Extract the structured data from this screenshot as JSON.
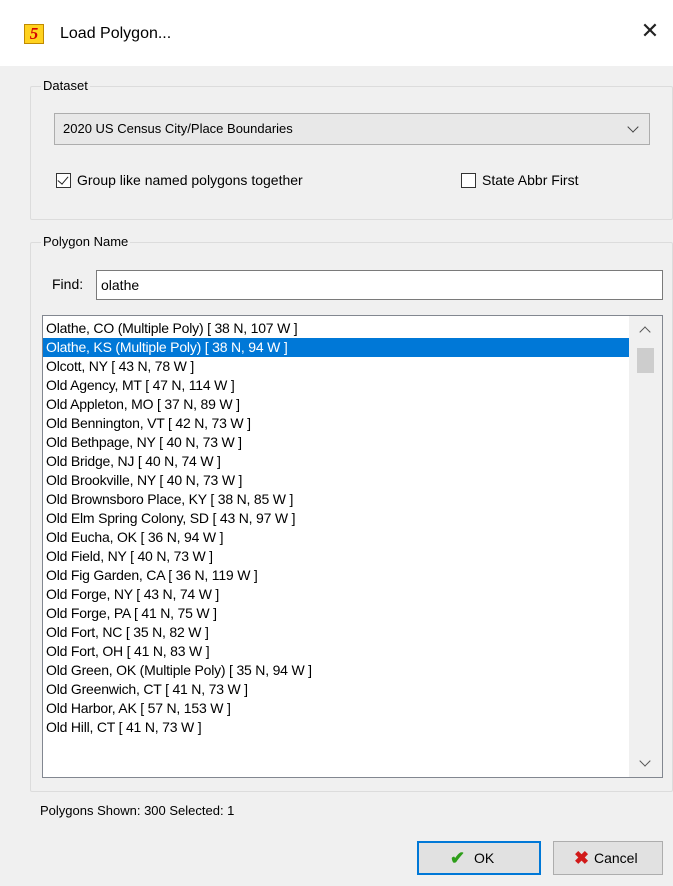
{
  "window": {
    "title": "Load Polygon...",
    "app_icon_glyph": "5",
    "close_glyph": "✕"
  },
  "dataset": {
    "legend": "Dataset",
    "selected": "2020 US Census City/Place Boundaries",
    "group_like_named": {
      "label": "Group like named polygons together",
      "checked": true
    },
    "state_abbr_first": {
      "label": "State Abbr First",
      "checked": false
    }
  },
  "polygon_name": {
    "legend": "Polygon Name",
    "find_label": "Find:",
    "find_value": "olathe",
    "items": [
      "Olathe, CO (Multiple Poly)  [ 38 N, 107 W ]",
      "Olathe, KS (Multiple Poly)  [ 38 N, 94 W ]",
      "Olcott, NY  [ 43 N, 78 W ]",
      "Old Agency, MT  [ 47 N, 114 W ]",
      "Old Appleton, MO  [ 37 N, 89 W ]",
      "Old Bennington, VT  [ 42 N, 73 W ]",
      "Old Bethpage, NY  [ 40 N, 73 W ]",
      "Old Bridge, NJ  [ 40 N, 74 W ]",
      "Old Brookville, NY  [ 40 N, 73 W ]",
      "Old Brownsboro Place, KY  [ 38 N, 85 W ]",
      "Old Elm Spring Colony, SD  [ 43 N, 97 W ]",
      "Old Eucha, OK  [ 36 N, 94 W ]",
      "Old Field, NY  [ 40 N, 73 W ]",
      "Old Fig Garden, CA  [ 36 N, 119 W ]",
      "Old Forge, NY  [ 43 N, 74 W ]",
      "Old Forge, PA  [ 41 N, 75 W ]",
      "Old Fort, NC  [ 35 N, 82 W ]",
      "Old Fort, OH  [ 41 N, 83 W ]",
      "Old Green, OK (Multiple Poly)  [ 35 N, 94 W ]",
      "Old Greenwich, CT  [ 41 N, 73 W ]",
      "Old Harbor, AK  [ 57 N, 153 W ]",
      "Old Hill, CT  [ 41 N, 73 W ]"
    ],
    "selected_index": 1
  },
  "status": {
    "text": "Polygons Shown: 300  Selected: 1"
  },
  "buttons": {
    "ok": {
      "label": "OK",
      "icon": "check-icon"
    },
    "cancel": {
      "label": "Cancel",
      "icon": "x-icon"
    }
  },
  "colors": {
    "selection": "#0078d7",
    "ok_check": "#2e9e1a",
    "cancel_x": "#d11a1a"
  }
}
